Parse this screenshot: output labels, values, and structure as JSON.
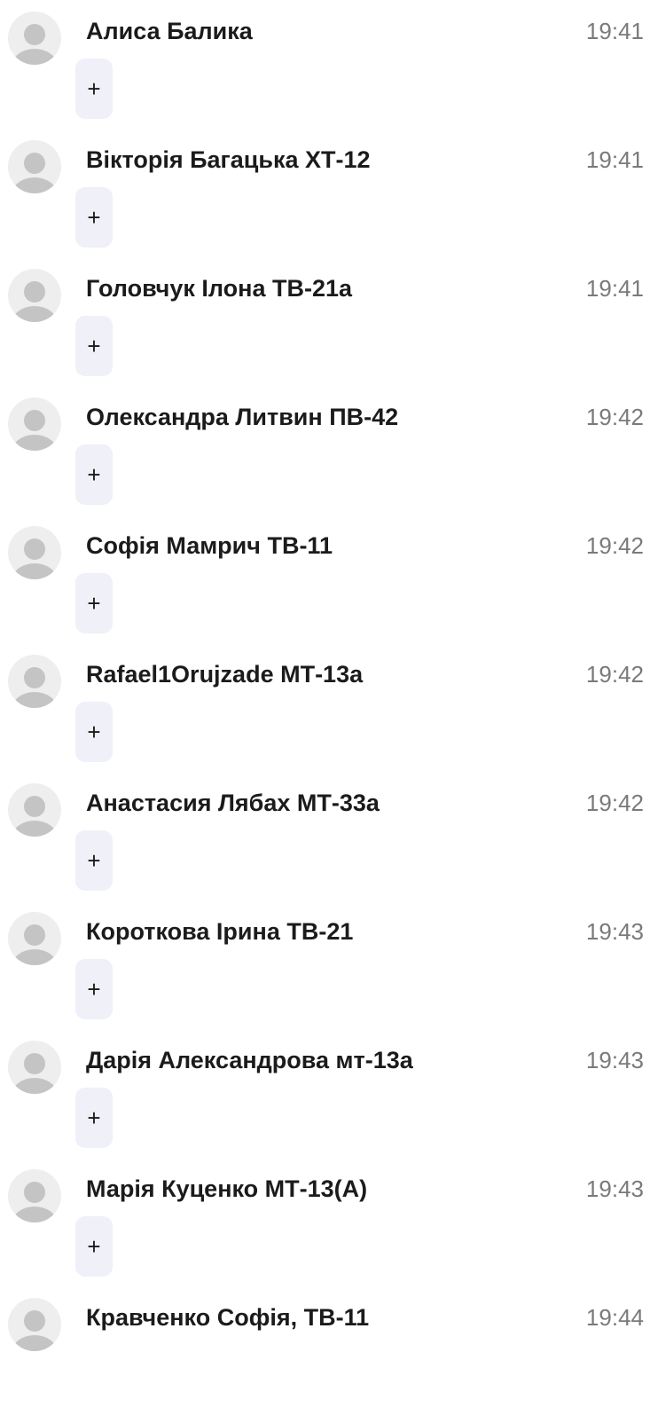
{
  "messages": [
    {
      "author": "Алиса Балика",
      "time": "19:41",
      "add_reaction_label": "+"
    },
    {
      "author": "Вікторія Багацька ХТ-12",
      "time": "19:41",
      "add_reaction_label": "+"
    },
    {
      "author": "Головчук Ілона ТВ-21а",
      "time": "19:41",
      "add_reaction_label": "+"
    },
    {
      "author": "Олександра Литвин ПВ-42",
      "time": "19:42",
      "add_reaction_label": "+"
    },
    {
      "author": "Софія Мамрич ТВ-11",
      "time": "19:42",
      "add_reaction_label": "+"
    },
    {
      "author": "Rafael1Orujzade МТ-13а",
      "time": "19:42",
      "add_reaction_label": "+"
    },
    {
      "author": "Анастасия Лябах МТ-33а",
      "time": "19:42",
      "add_reaction_label": "+"
    },
    {
      "author": "Короткова Ірина ТВ-21",
      "time": "19:43",
      "add_reaction_label": "+"
    },
    {
      "author": "Дарія Александрова мт-13а",
      "time": "19:43",
      "add_reaction_label": "+"
    },
    {
      "author": "Марія Куценко МТ-13(А)",
      "time": "19:43",
      "add_reaction_label": "+"
    },
    {
      "author": "Кравченко Софія, ТВ-11",
      "time": "19:44"
    }
  ]
}
